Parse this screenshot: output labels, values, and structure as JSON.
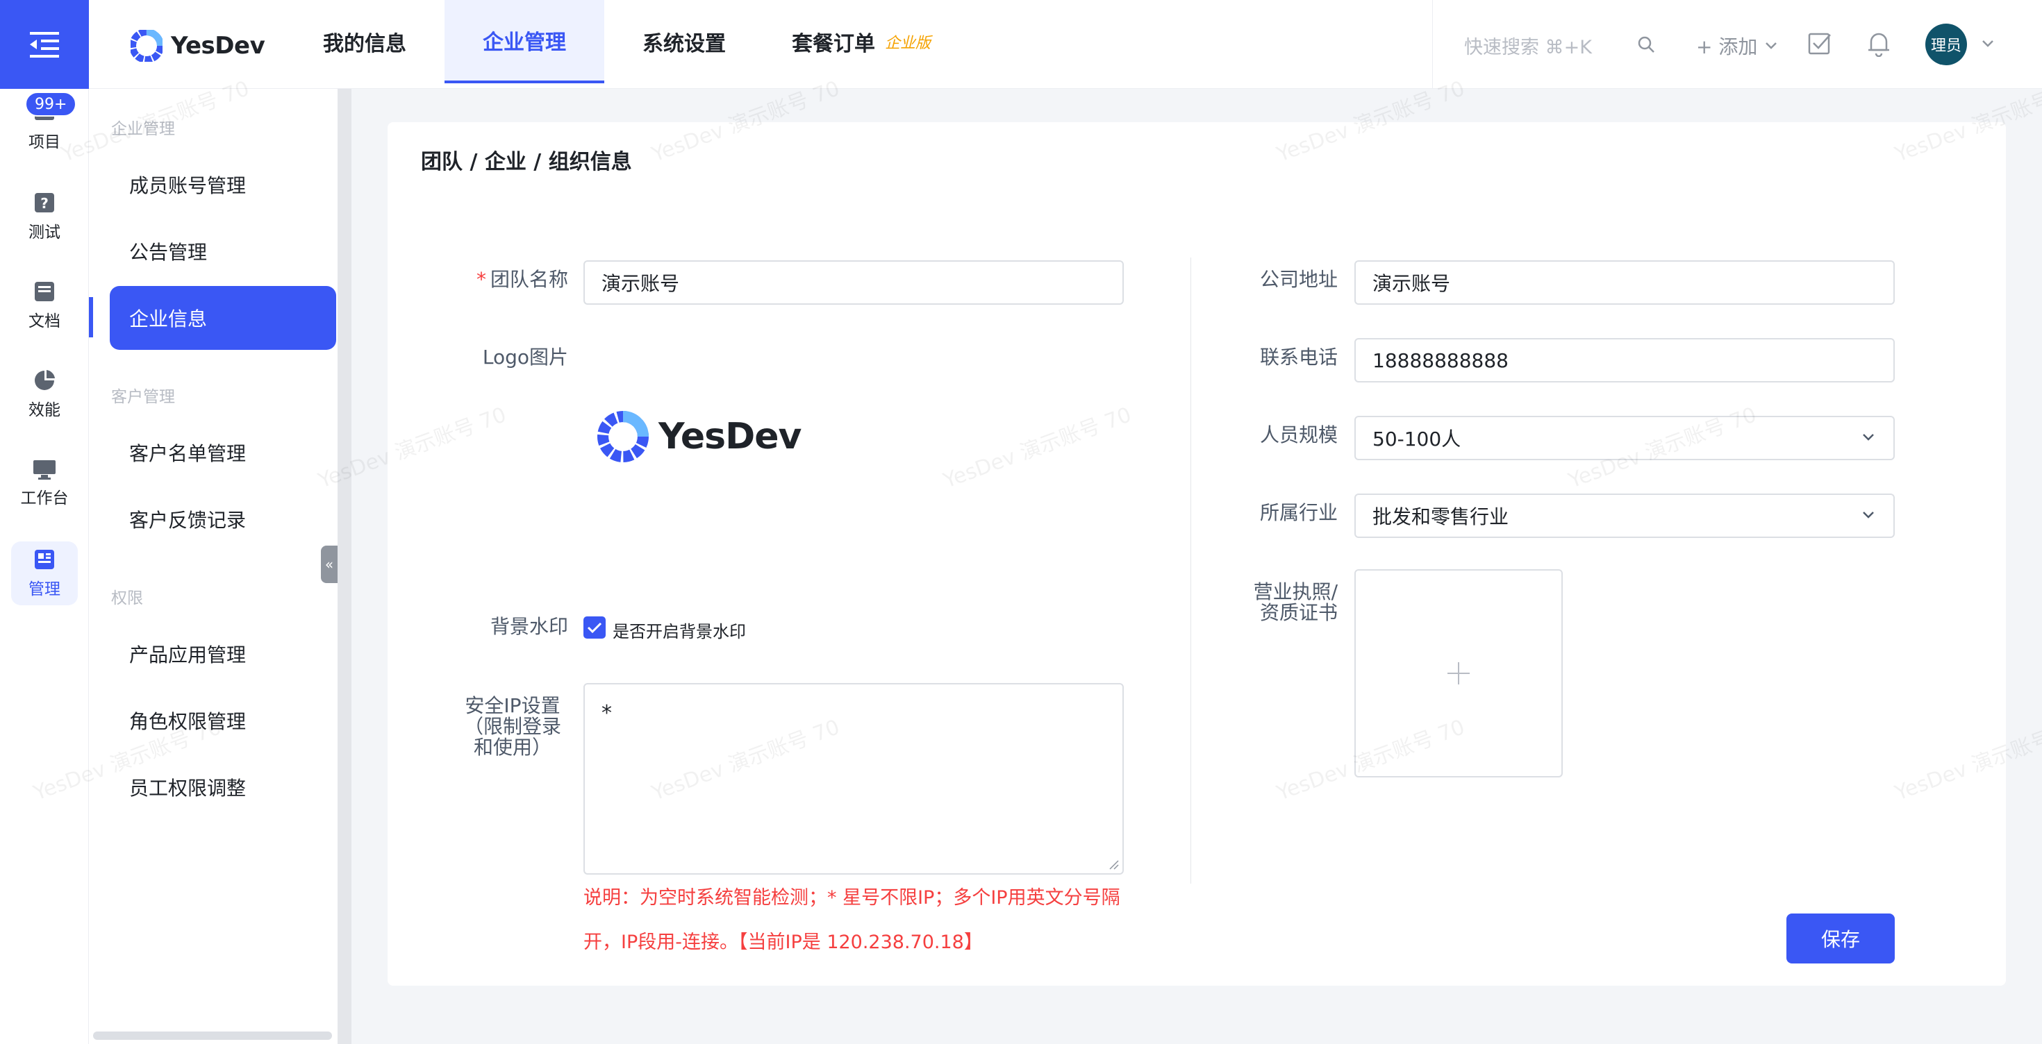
{
  "header": {
    "logo_text": "YesDev",
    "nav": [
      {
        "label": "我的信息"
      },
      {
        "label": "企业管理"
      },
      {
        "label": "系统设置"
      },
      {
        "label": "套餐订单",
        "badge": "企业版"
      }
    ],
    "search_hint": "快速搜索 ⌘+K",
    "add_label": "+ 添加",
    "avatar_text": "理员"
  },
  "rail": {
    "badge": "99+",
    "items": [
      {
        "label": "项目",
        "icon": "project-icon"
      },
      {
        "label": "测试",
        "icon": "test-icon"
      },
      {
        "label": "文档",
        "icon": "document-icon"
      },
      {
        "label": "效能",
        "icon": "pie-chart-icon"
      },
      {
        "label": "工作台",
        "icon": "monitor-icon"
      },
      {
        "label": "管理",
        "icon": "dashboard-icon"
      }
    ]
  },
  "sidebar": {
    "groups": [
      {
        "title": "企业管理",
        "items": [
          "成员账号管理",
          "公告管理",
          "企业信息"
        ]
      },
      {
        "title": "客户管理",
        "items": [
          "客户名单管理",
          "客户反馈记录"
        ]
      },
      {
        "title": "权限",
        "items": [
          "产品应用管理",
          "角色权限管理",
          "员工权限调整"
        ]
      }
    ]
  },
  "breadcrumb": "团队 / 企业 / 组织信息",
  "form": {
    "team_name": {
      "required": "*",
      "label": "团队名称",
      "value": "演示账号"
    },
    "logo": {
      "label": "Logo图片",
      "logo_text": "YesDev"
    },
    "watermark": {
      "label": "背景水印",
      "checkbox_label": "是否开启背景水印",
      "checked": true
    },
    "ip": {
      "label_lines": [
        "安全IP设置",
        "（限制登录",
        "和使用）"
      ],
      "value": "*",
      "hint": "说明：为空时系统智能检测；* 星号不限IP；多个IP用英文分号隔开，IP段用-连接。【当前IP是 120.238.70.18】"
    },
    "address": {
      "label": "公司地址",
      "value": "演示账号"
    },
    "phone": {
      "label": "联系电话",
      "value": "18888888888"
    },
    "size": {
      "label": "人员规模",
      "value": "50-100人"
    },
    "industry": {
      "label": "所属行业",
      "value": "批发和零售行业"
    },
    "license": {
      "label_lines": [
        "营业执照/",
        "资质证书"
      ]
    },
    "save_label": "保存"
  },
  "watermark_text": "YesDev 演示账号 70",
  "colors": {
    "primary": "#3a57f4",
    "danger": "#f53f3f",
    "badge": "#f5a200"
  }
}
